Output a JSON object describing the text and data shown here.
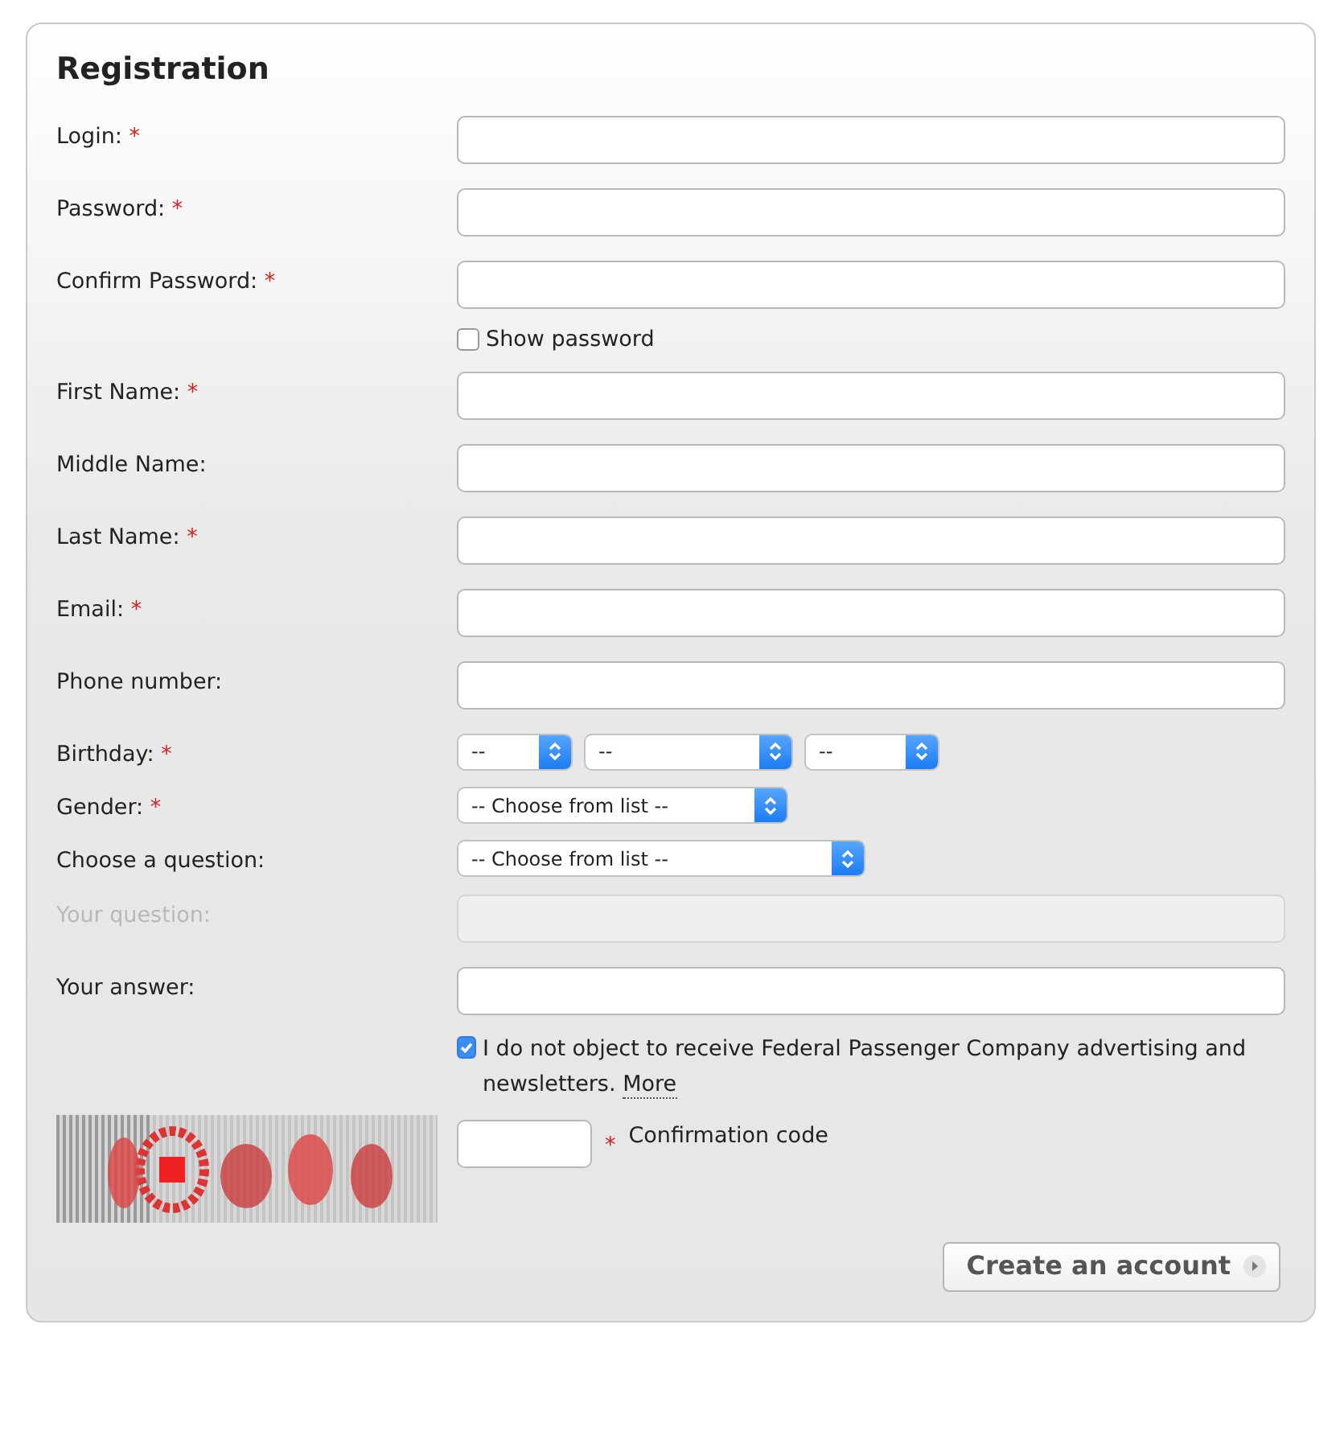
{
  "title": "Registration",
  "rows": [
    {
      "kind": "text",
      "label": "Login:",
      "required_mark": "*",
      "disabled": false
    },
    {
      "kind": "text",
      "label": "Password:",
      "required_mark": "*",
      "disabled": false
    },
    {
      "kind": "text",
      "label": "Confirm Password:",
      "required_mark": "*",
      "disabled": false
    },
    {
      "kind": "checkbox",
      "text": "Show password",
      "checked": false
    },
    {
      "kind": "text",
      "label": "First Name:",
      "required_mark": "*",
      "disabled": false
    },
    {
      "kind": "text",
      "label": "Middle Name:",
      "disabled": false
    },
    {
      "kind": "text",
      "label": "Last Name:",
      "required_mark": "*",
      "disabled": false
    },
    {
      "kind": "text",
      "label": "Email:",
      "required_mark": "*",
      "disabled": false
    },
    {
      "kind": "text",
      "label": "Phone number:",
      "disabled": false
    },
    {
      "kind": "select",
      "label": "Birthday:",
      "required_mark": "*",
      "selects": [
        {
          "value": "--"
        },
        {
          "value": "--"
        },
        {
          "value": "--"
        }
      ]
    },
    {
      "kind": "select",
      "label": "Gender:",
      "required_mark": "*",
      "selects": [
        {
          "value": "-- Choose from list --"
        }
      ]
    },
    {
      "kind": "select",
      "label": "Choose a question:",
      "selects": [
        {
          "value": "-- Choose from list --"
        }
      ]
    },
    {
      "kind": "text",
      "label": "Your question:",
      "disabled": true
    },
    {
      "kind": "text",
      "label": "Your answer:",
      "disabled": false
    }
  ],
  "consent": {
    "checked": true,
    "text": "I do not object to receive Federal Passenger Company advertising and newsletters.",
    "link": "More"
  },
  "captcha": {
    "kind": "picture",
    "required_mark": "*",
    "label": "Confirmation code"
  },
  "submit": "Create an account"
}
